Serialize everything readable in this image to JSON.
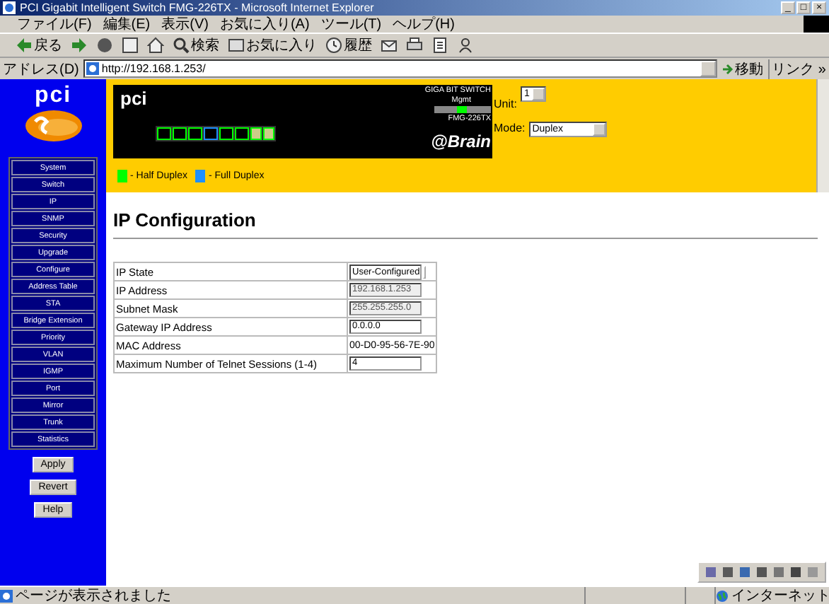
{
  "window": {
    "title": "PCI Gigabit Intelligent Switch FMG-226TX - Microsoft Internet Explorer",
    "controls": [
      "_",
      "□",
      "×"
    ]
  },
  "menu": [
    "ファイル(F)",
    "編集(E)",
    "表示(V)",
    "お気に入り(A)",
    "ツール(T)",
    "ヘルプ(H)"
  ],
  "toolbar": [
    {
      "kind": "back",
      "label": "戻る"
    },
    {
      "kind": "forward"
    },
    {
      "kind": "stop"
    },
    {
      "kind": "refresh"
    },
    {
      "kind": "home"
    },
    {
      "kind": "search",
      "label": "検索"
    },
    {
      "kind": "favorites",
      "label": "お気に入り"
    },
    {
      "kind": "history",
      "label": "履歴"
    },
    {
      "kind": "mail"
    },
    {
      "kind": "print"
    },
    {
      "kind": "edit"
    },
    {
      "kind": "messenger"
    }
  ],
  "address": {
    "label": "アドレス(D)",
    "value": "http://192.168.1.253/",
    "go": "移動",
    "links": "リンク »"
  },
  "sidebar": {
    "logo": "pci",
    "items": [
      "System",
      "Switch",
      "IP",
      "SNMP",
      "Security",
      "Upgrade",
      "Configure",
      "Address Table",
      "STA",
      "Bridge Extension",
      "Priority",
      "VLAN",
      "IGMP",
      "Port",
      "Mirror",
      "Trunk",
      "Statistics"
    ],
    "buttons": [
      "Apply",
      "Revert",
      "Help"
    ]
  },
  "panel": {
    "logo": "pci",
    "device_title": "GIGA BIT SWITCH",
    "mgmt": "Mgmt",
    "model": "FMG-226TX",
    "brand": "@Brain",
    "ports": [
      {
        "kind": "rj45",
        "color": "#00ff00"
      },
      {
        "kind": "rj45",
        "color": "#00ff00"
      },
      {
        "kind": "rj45",
        "color": "#00ff00"
      },
      {
        "kind": "rj45",
        "color": "#1e90ff"
      },
      {
        "kind": "rj45",
        "color": "#00ff00"
      },
      {
        "kind": "rj45",
        "color": "#00ff00"
      },
      {
        "kind": "gbic",
        "color": "#00ff00"
      },
      {
        "kind": "gbic",
        "color": "#00ff00"
      }
    ],
    "unit": {
      "label": "Unit:",
      "value": "1"
    },
    "mode": {
      "label": "Mode:",
      "value": "Duplex"
    },
    "legend": [
      {
        "label": "- Half Duplex",
        "color": "#00ff00"
      },
      {
        "label": "- Full Duplex",
        "color": "#1e90ff"
      }
    ]
  },
  "page": {
    "heading": "IP Configuration",
    "rows": [
      {
        "label": "IP State",
        "kind": "select",
        "value": "User-Configured"
      },
      {
        "label": "IP Address",
        "kind": "input",
        "value": "192.168.1.253",
        "disabled": true
      },
      {
        "label": "Subnet Mask",
        "kind": "input",
        "value": "255.255.255.0",
        "disabled": true
      },
      {
        "label": "Gateway IP Address",
        "kind": "input",
        "value": "0.0.0.0",
        "disabled": false
      },
      {
        "label": "MAC Address",
        "kind": "text",
        "value": "00-D0-95-56-7E-90"
      },
      {
        "label": "Maximum Number of Telnet Sessions (1-4)",
        "kind": "input",
        "value": "4",
        "disabled": false
      }
    ]
  },
  "status_bar": {
    "message": "ページが表示されました",
    "zone": "インターネット"
  }
}
